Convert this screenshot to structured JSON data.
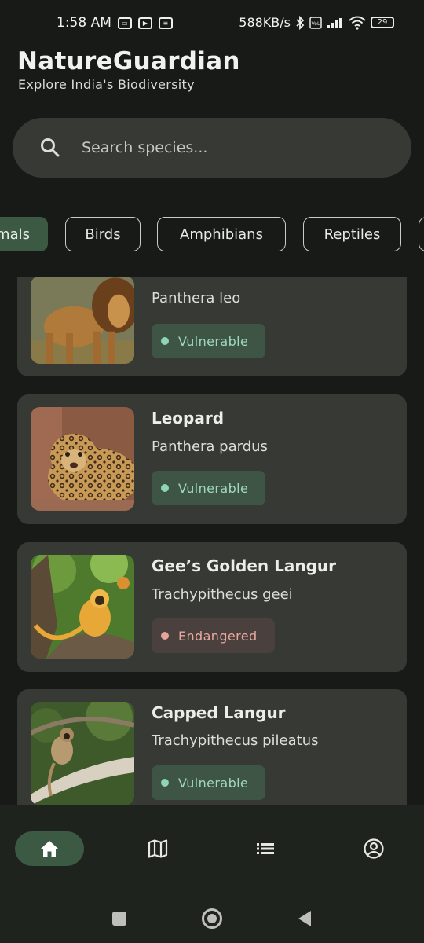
{
  "status_bar": {
    "time": "1:58 AM",
    "speed": "588KB/s",
    "battery": "29"
  },
  "header": {
    "title": "NatureGuardian",
    "subtitle": "Explore India's Biodiversity"
  },
  "search": {
    "placeholder": "Search species..."
  },
  "categories": [
    {
      "label": "mals",
      "selected": true
    },
    {
      "label": "Birds",
      "selected": false
    },
    {
      "label": "Amphibians",
      "selected": false
    },
    {
      "label": "Reptiles",
      "selected": false
    }
  ],
  "species": [
    {
      "name": "",
      "scientific": "Panthera leo",
      "status": "Vulnerable",
      "image": "lion"
    },
    {
      "name": "Leopard",
      "scientific": "Panthera pardus",
      "status": "Vulnerable",
      "image": "leopard"
    },
    {
      "name": "Gee’s Golden Langur",
      "scientific": "Trachypithecus geei",
      "status": "Endangered",
      "image": "golden-langur"
    },
    {
      "name": "Capped Langur",
      "scientific": "Trachypithecus pileatus",
      "status": "Vulnerable",
      "image": "capped-langur"
    }
  ],
  "colors": {
    "background": "#171a17",
    "card": "#373a34",
    "accent": "#3c5a43",
    "vulnerable": "#8fd5b6",
    "endangered": "#e6a39b"
  },
  "bottom_nav": [
    {
      "icon": "home-icon",
      "active": true
    },
    {
      "icon": "map-icon",
      "active": false
    },
    {
      "icon": "list-icon",
      "active": false
    },
    {
      "icon": "profile-icon",
      "active": false
    }
  ]
}
